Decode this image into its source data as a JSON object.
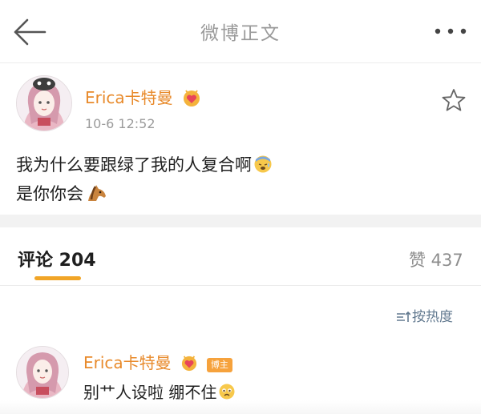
{
  "nav": {
    "title": "微博正文",
    "back_icon": "arrow-left-icon",
    "more_icon": "more-dots-icon"
  },
  "post": {
    "username": "Erica卡特曼",
    "time": "10-6 12:52",
    "lines": [
      "我为什么要跟绿了我的人复合啊",
      "是你你会"
    ],
    "badge_icon": "vip-heart-badge-icon",
    "favorite_icon": "star-outline-icon"
  },
  "comments_header": {
    "comments_label": "评论 204",
    "likes_label": "赞 437",
    "sort_label": "按热度",
    "accent_color": "#f1a527"
  },
  "comment": {
    "username": "Erica卡特曼",
    "author_tag": "博主",
    "text": "别艹人设啦 绷不住"
  },
  "colors": {
    "username": "#e88a2b",
    "link_blue": "#637a90",
    "muted": "#9b9b9b"
  }
}
